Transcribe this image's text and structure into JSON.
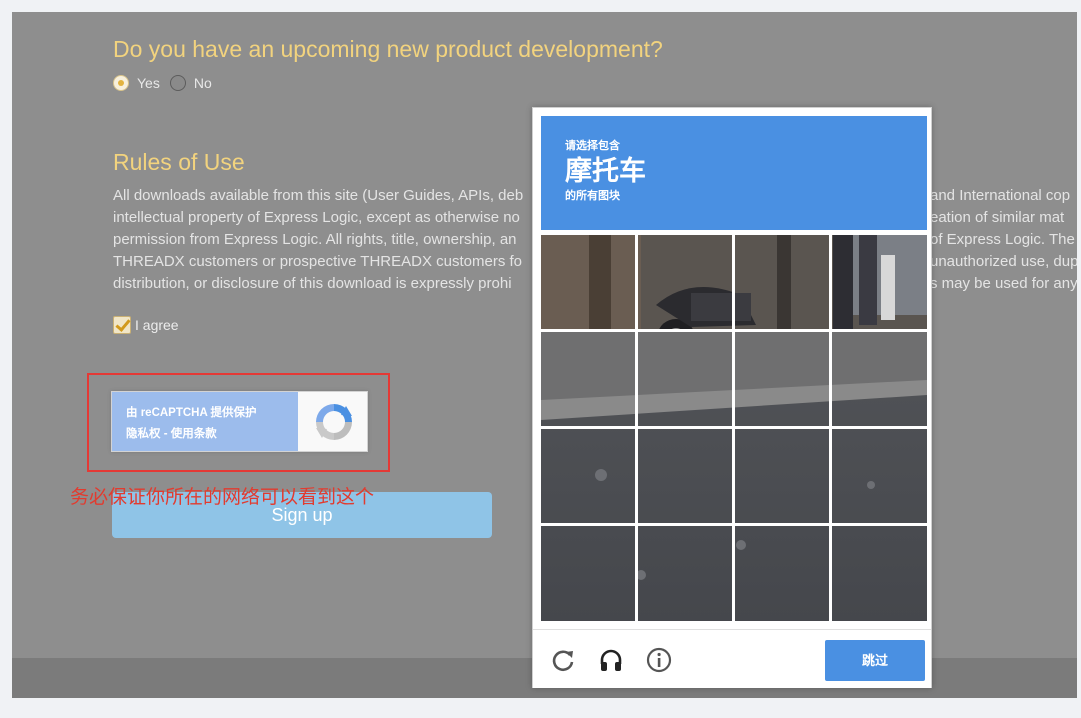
{
  "form": {
    "question": "Do you have an upcoming new product development?",
    "options": [
      {
        "label": "Yes",
        "checked": true
      },
      {
        "label": "No",
        "checked": false
      }
    ],
    "rules_title": "Rules of Use",
    "rules_lines": [
      "All downloads available from this site (User Guides, APIs, deb",
      "intellectual property of Express Logic, except as otherwise no",
      "permission from Express Logic. All rights, title, ownership, an",
      "THREADX customers or prospective THREADX customers fo",
      "distribution, or disclosure of this download is expressly prohi"
    ],
    "rules_lines_right": [
      "and International cop",
      "eation of similar mat",
      "of Express Logic. The",
      "unauthorized use, dup",
      "s may be used for any"
    ],
    "agree_label": "I agree",
    "recaptcha_line1": "由 reCAPTCHA 提供保护",
    "recaptcha_line2": "隐私权 - 使用条款",
    "signup_label": "Sign up",
    "red_note": "务必保证你所在的网络可以看到这个"
  },
  "challenge": {
    "prompt_top": "请选择包含",
    "prompt_object": "摩托车",
    "prompt_bottom": "的所有图块",
    "skip_label": "跳过",
    "icons": [
      "reload-icon",
      "audio-icon",
      "info-icon"
    ]
  },
  "colors": {
    "accent_yellow": "#f2d37e",
    "captcha_blue": "#4a90e2",
    "annotation_red": "#e53935"
  }
}
